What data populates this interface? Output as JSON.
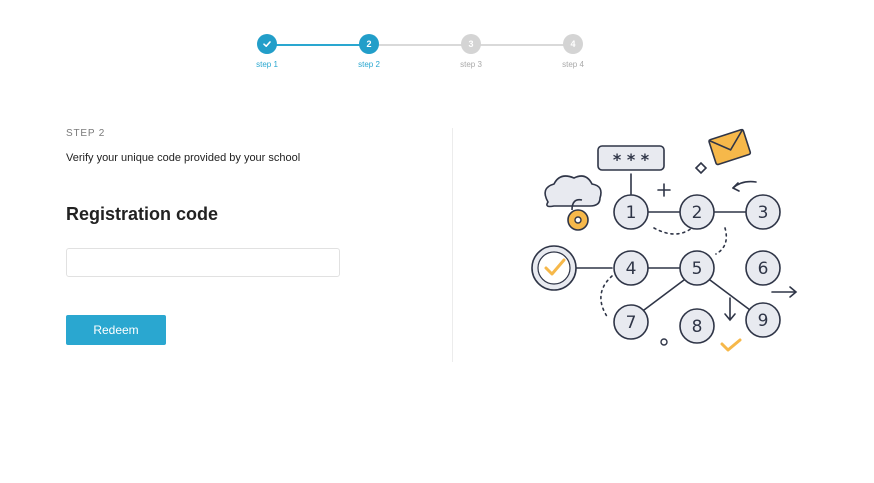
{
  "stepper": {
    "steps": [
      {
        "label": "step 1",
        "state": "done",
        "icon": "check-icon"
      },
      {
        "label": "step 2",
        "state": "current",
        "number": "2"
      },
      {
        "label": "step 3",
        "state": "upcoming",
        "number": "3"
      },
      {
        "label": "step 4",
        "state": "upcoming",
        "number": "4"
      }
    ],
    "accent_color": "#2aa7d0"
  },
  "form": {
    "step_kicker": "STEP 2",
    "instructions": "Verify your unique code provided by your school",
    "title": "Registration code",
    "code_input": {
      "value": "",
      "placeholder": ""
    },
    "submit_label": "Redeem"
  },
  "illustration": {
    "password_mask": "* * *",
    "nodes": [
      "1",
      "2",
      "3",
      "4",
      "5",
      "6",
      "7",
      "8",
      "9"
    ],
    "icons": [
      "envelope-icon",
      "cloud-icon",
      "padlock-icon",
      "check-circle-icon"
    ]
  }
}
